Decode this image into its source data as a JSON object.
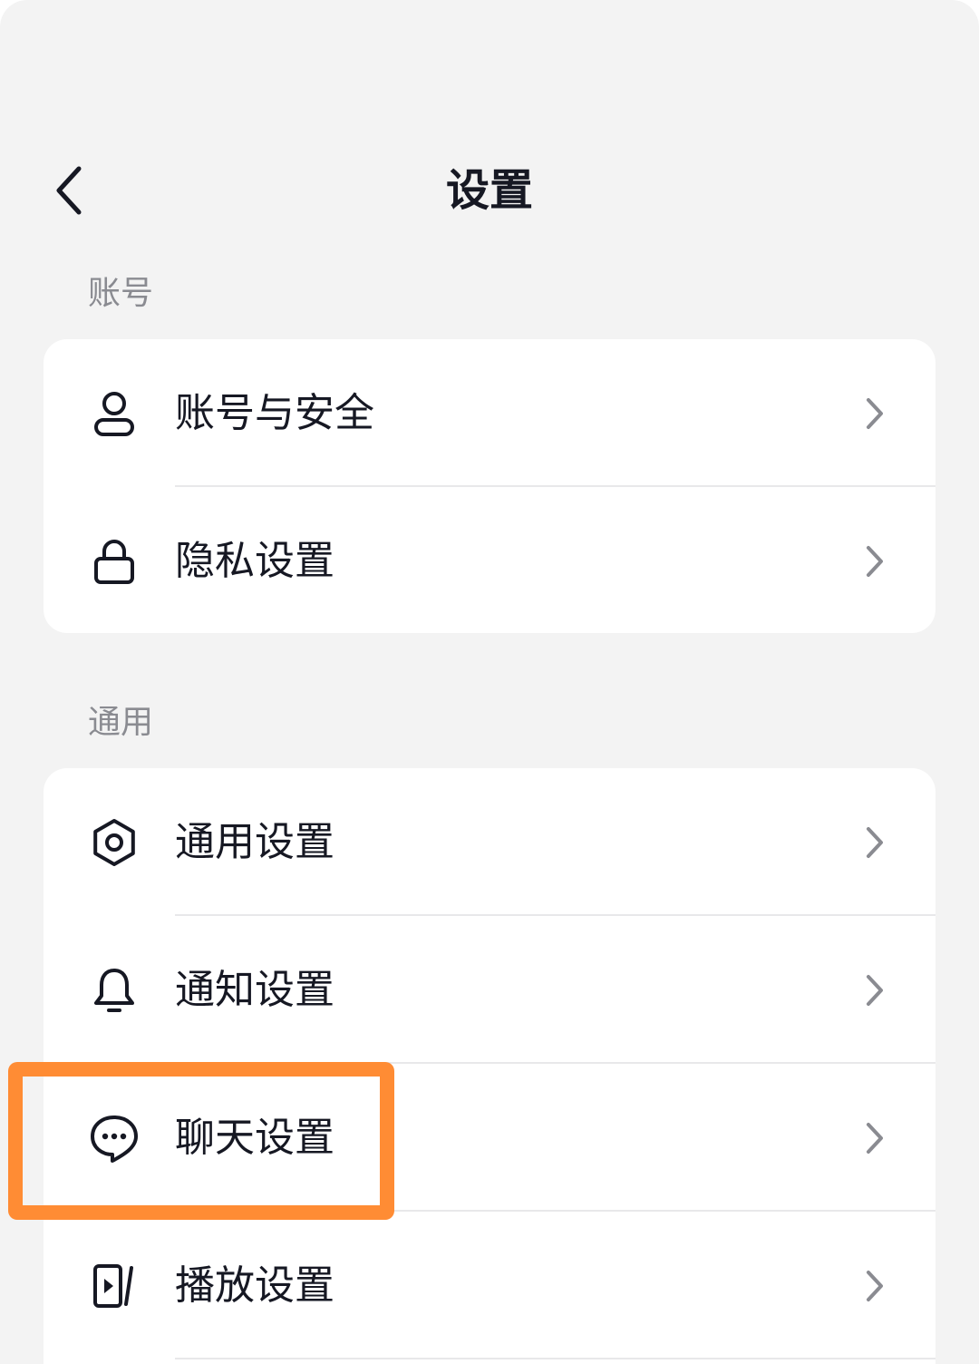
{
  "header": {
    "title": "设置"
  },
  "sections": [
    {
      "header": "账号",
      "items": [
        {
          "label": "账号与安全",
          "icon": "user-icon"
        },
        {
          "label": "隐私设置",
          "icon": "lock-icon"
        }
      ]
    },
    {
      "header": "通用",
      "items": [
        {
          "label": "通用设置",
          "icon": "gear-icon"
        },
        {
          "label": "通知设置",
          "icon": "bell-icon"
        },
        {
          "label": "聊天设置",
          "icon": "chat-bubble-icon"
        },
        {
          "label": "播放设置",
          "icon": "play-screen-icon"
        }
      ]
    }
  ],
  "colors": {
    "background": "#f3f3f3",
    "card": "#ffffff",
    "text_primary": "#161823",
    "text_secondary": "#8a8b91",
    "chevron": "#8a8b91",
    "divider": "#e8e8ea",
    "highlight": "#ff8c34"
  }
}
